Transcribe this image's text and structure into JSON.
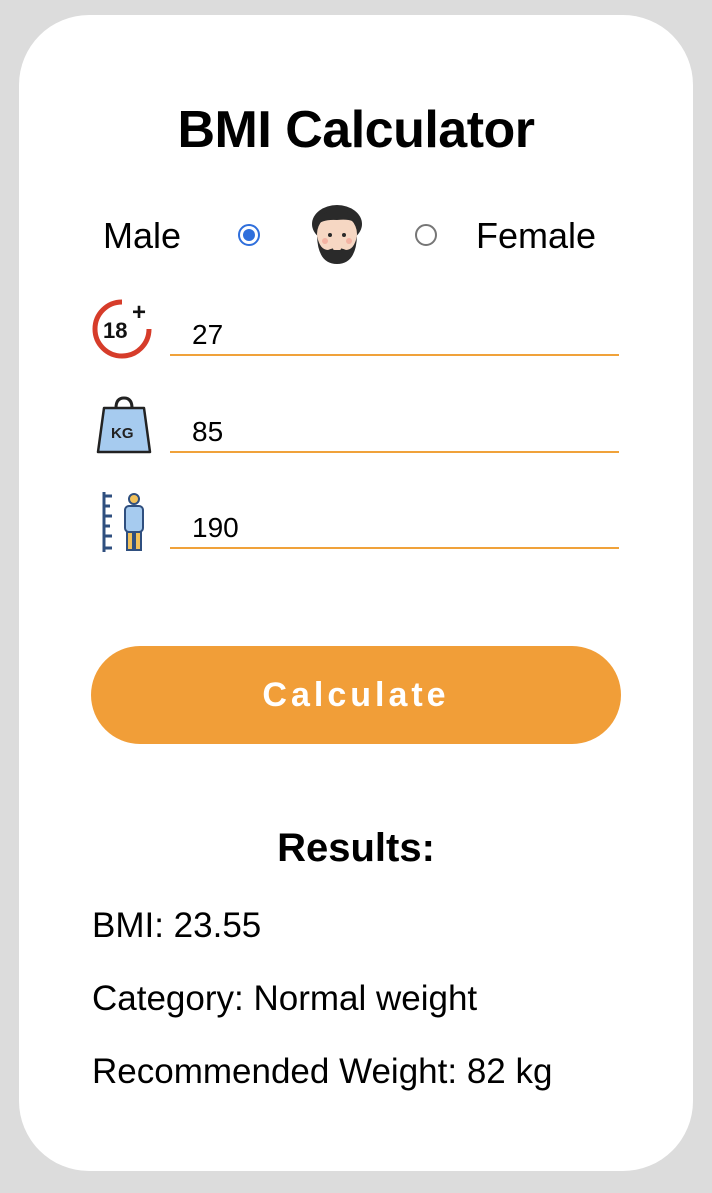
{
  "title": "BMI Calculator",
  "gender": {
    "male_label": "Male",
    "female_label": "Female",
    "selected": "male",
    "avatar_icon": "man-with-beard-icon"
  },
  "fields": {
    "age": {
      "value": "27",
      "icon": "age-18-plus-icon"
    },
    "weight": {
      "value": "85",
      "icon": "kg-weight-icon"
    },
    "height": {
      "value": "190",
      "icon": "height-ruler-person-icon"
    }
  },
  "button": {
    "label": "Calculate"
  },
  "results": {
    "title": "Results:",
    "bmi": "BMI: 23.55",
    "category": "Category: Normal weight",
    "recommended": "Recommended Weight: 82 kg"
  },
  "colors": {
    "accent": "#f19e38",
    "underline": "#f0a23a",
    "radio_selected": "#2f6fdc",
    "background": "#dcdcdc",
    "card": "#ffffff"
  }
}
